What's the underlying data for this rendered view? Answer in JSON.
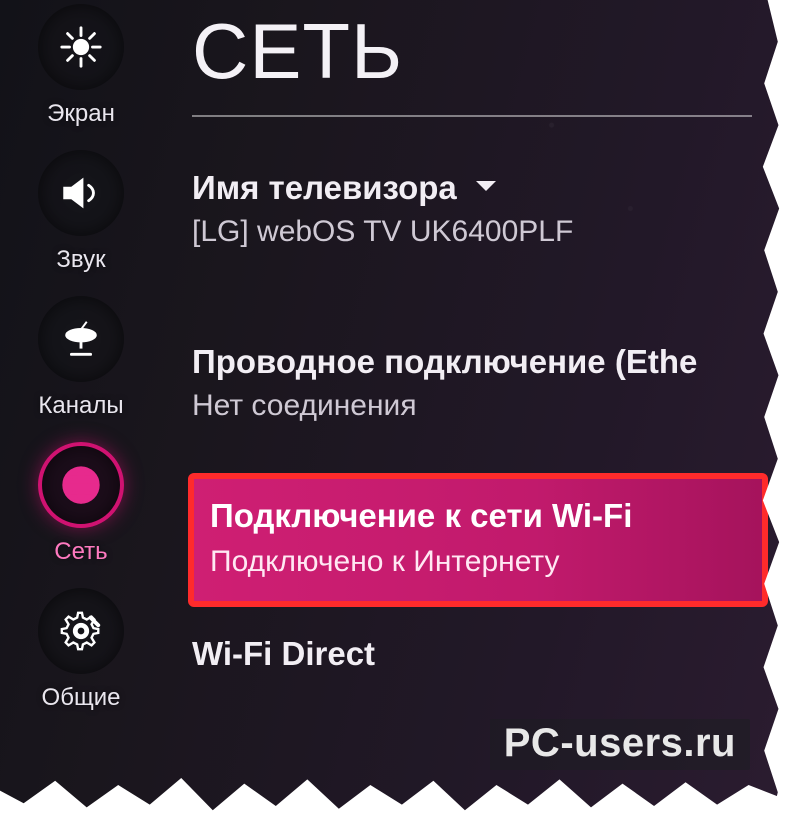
{
  "colors": {
    "accent": "#d01271",
    "highlight_bg": "#cf1f73",
    "highlight_outline": "#ff2b2b"
  },
  "sidebar": {
    "items": [
      {
        "id": "screen",
        "label": "Экран",
        "icon": "brightness-icon",
        "active": false
      },
      {
        "id": "sound",
        "label": "Звук",
        "icon": "speaker-icon",
        "active": false
      },
      {
        "id": "channels",
        "label": "Каналы",
        "icon": "satellite-icon",
        "active": false
      },
      {
        "id": "network",
        "label": "Сеть",
        "icon": "globe-icon",
        "active": true
      },
      {
        "id": "general",
        "label": "Общие",
        "icon": "gear-icon",
        "active": false
      }
    ]
  },
  "page": {
    "title": "СЕТЬ"
  },
  "rows": {
    "tv_name": {
      "title": "Имя телевизора",
      "value": "[LG] webOS TV UK6400PLF"
    },
    "wired": {
      "title": "Проводное подключение (Ethe",
      "status": "Нет соединения"
    },
    "wifi": {
      "title": "Подключение к сети Wi-Fi",
      "status": "Подключено к Интернету"
    },
    "wifi_direct": {
      "title": "Wi-Fi Direct"
    }
  },
  "watermark": "PC-users.ru"
}
